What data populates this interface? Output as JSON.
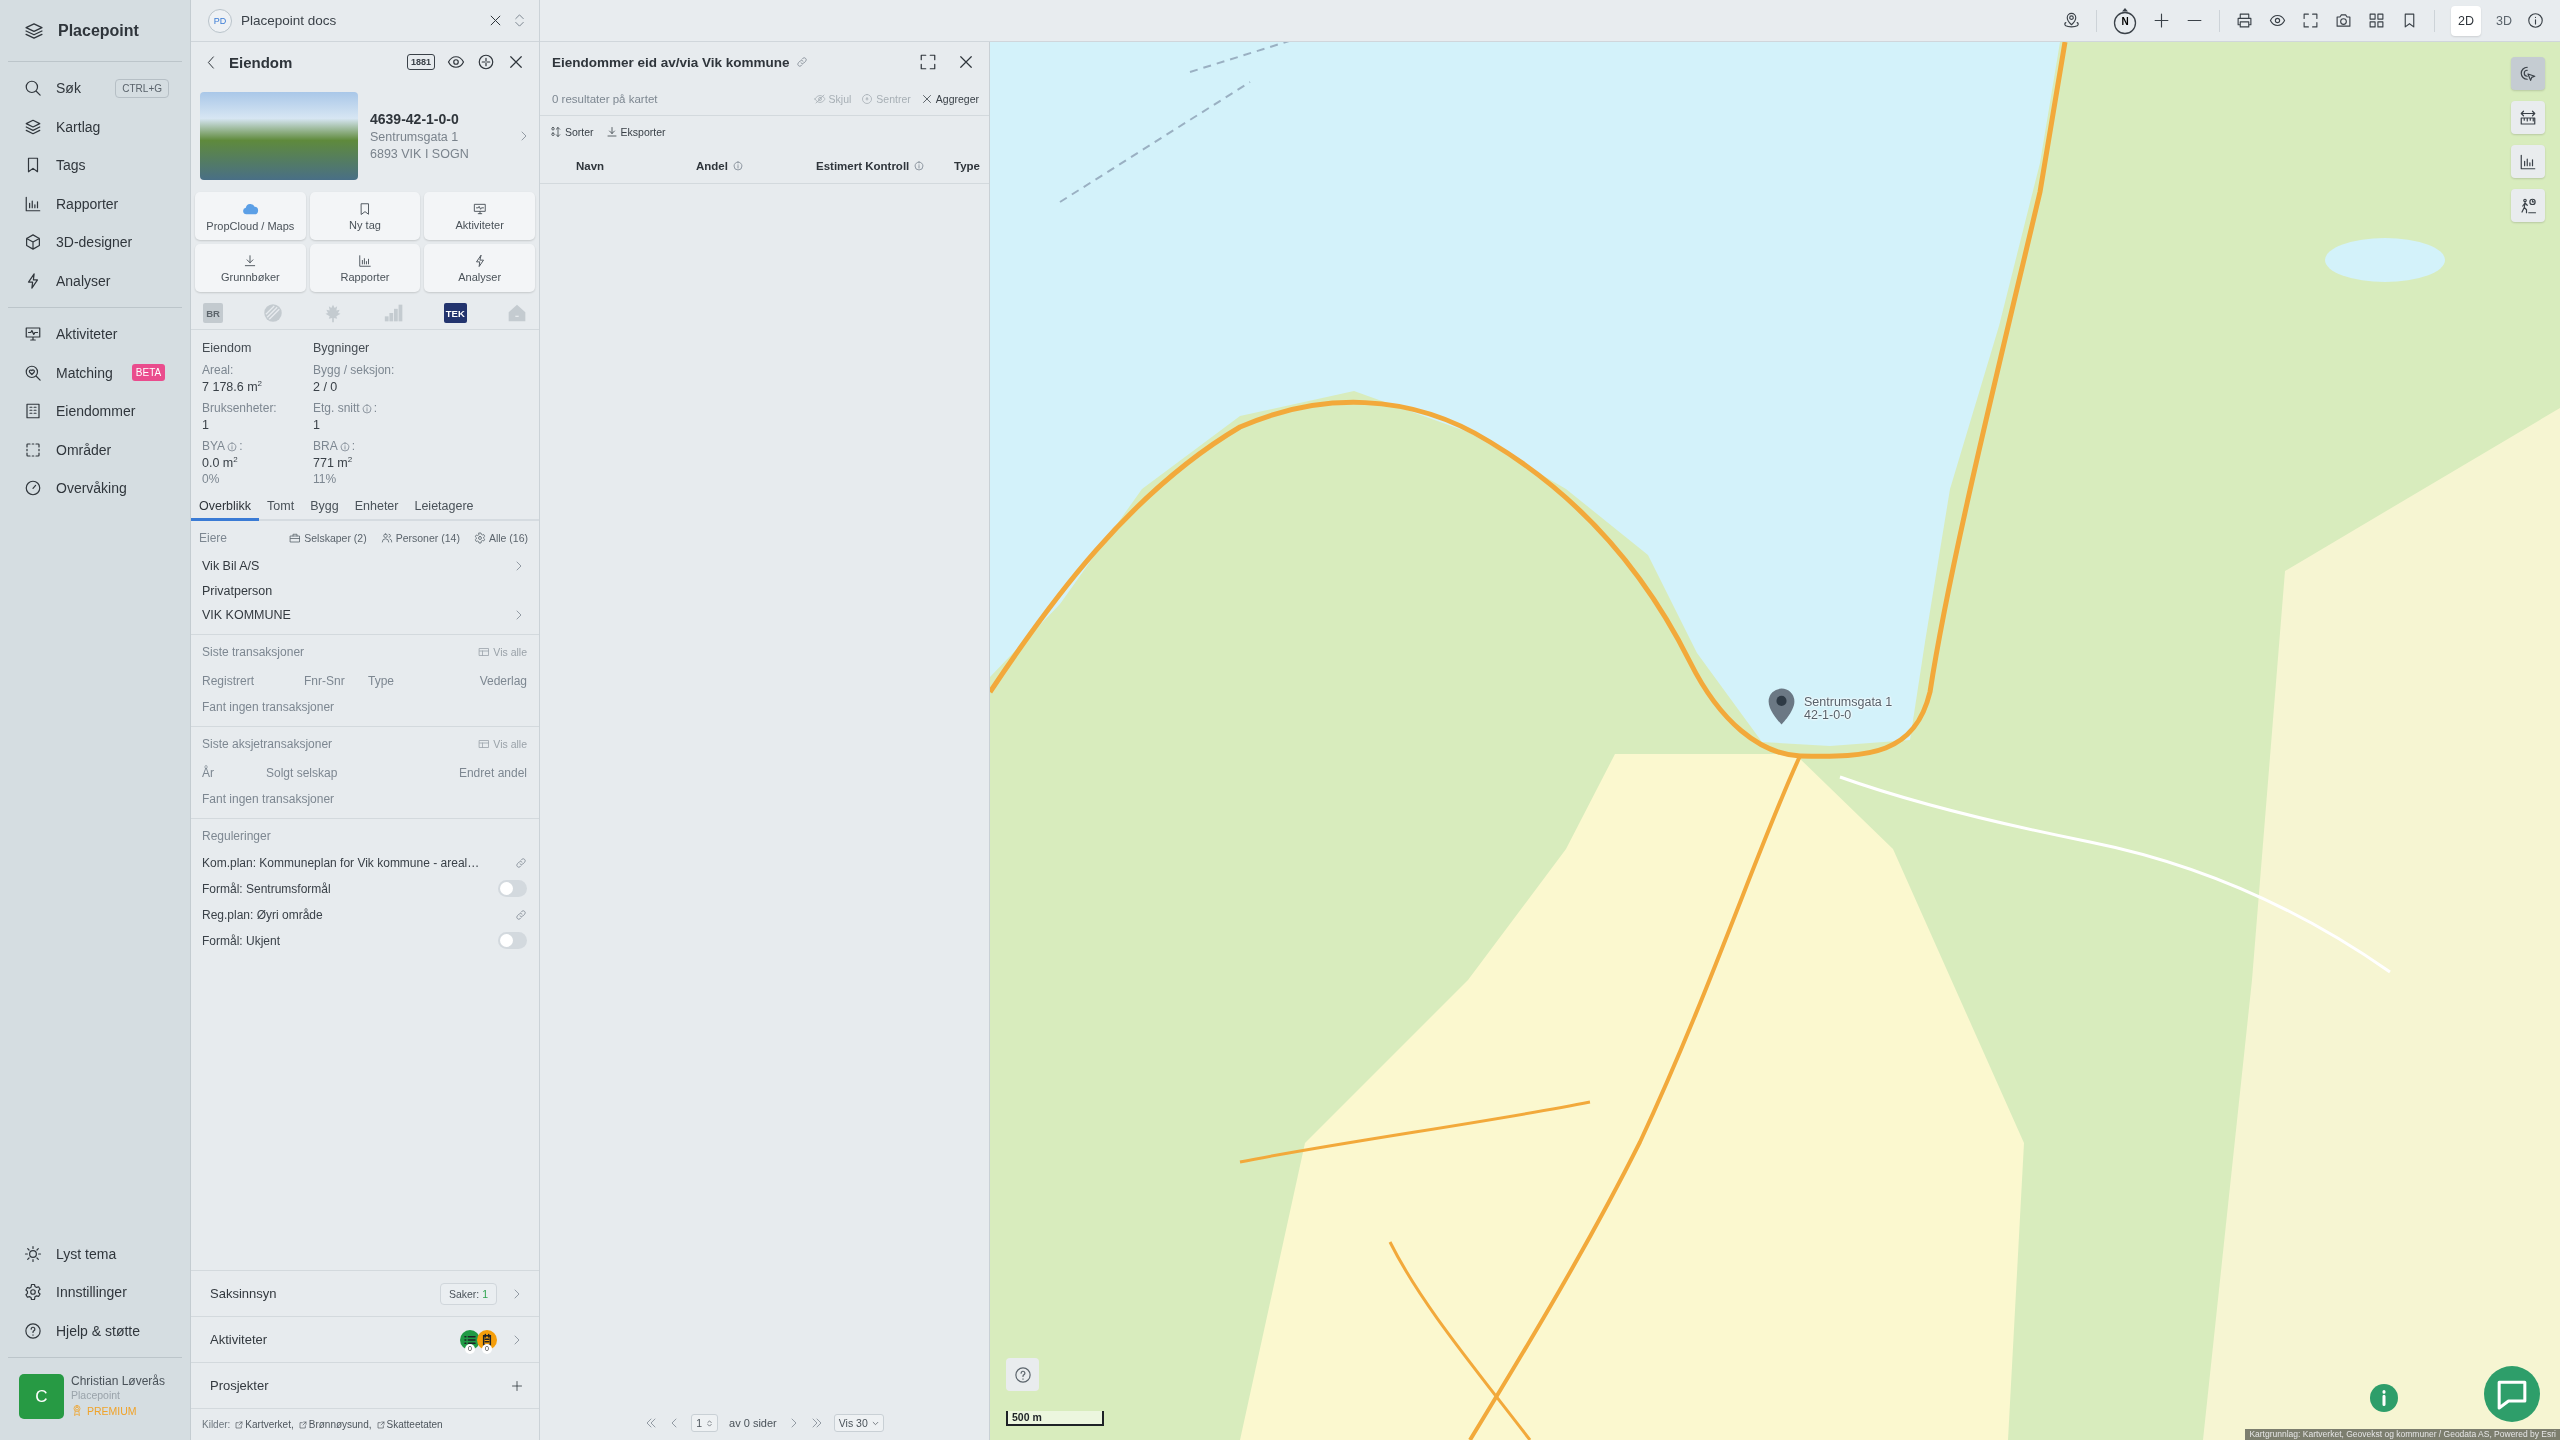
{
  "sidebar": {
    "brand": "Placepoint",
    "nav": [
      {
        "label": "Søk",
        "shortcut": "CTRL+G",
        "selected": false
      },
      {
        "label": "Kartlag",
        "selected": false
      },
      {
        "label": "Tags",
        "selected": false
      },
      {
        "label": "Rapporter",
        "selected": false
      },
      {
        "label": "3D-designer",
        "selected": false
      },
      {
        "label": "Analyser",
        "selected": false
      }
    ],
    "nav_secondary": [
      {
        "label": "Aktiviteter",
        "selected": false
      },
      {
        "label": "Matching",
        "badge": "BETA",
        "selected": false
      },
      {
        "label": "Eiendommer",
        "selected": false
      },
      {
        "label": "Områder",
        "selected": false
      },
      {
        "label": "Overvåking",
        "selected": false
      }
    ],
    "footer_nav": [
      {
        "label": "Lyst tema"
      },
      {
        "label": "Innstillinger"
      },
      {
        "label": "Hjelp & støtte"
      }
    ],
    "user": {
      "initial": "C",
      "name": "Christian Løverås",
      "organization": "Placepoint",
      "plan": "PREMIUM"
    }
  },
  "property_panel": {
    "workspace": {
      "initials": "PD",
      "name": "Placepoint docs"
    },
    "title": "Eiendom",
    "header_badge": "1881",
    "property": {
      "id": "4639-42-1-0-0",
      "address": "Sentrumsgata 1",
      "postal": "6893 VIK I SOGN"
    },
    "actions": [
      {
        "label": "PropCloud / Maps"
      },
      {
        "label": "Ny tag"
      },
      {
        "label": "Aktiviteter"
      },
      {
        "label": "Grunnbøker"
      },
      {
        "label": "Rapporter"
      },
      {
        "label": "Analyser"
      }
    ],
    "data_sources": [
      {
        "kind": "badge",
        "text": "BR",
        "disabled": true
      },
      {
        "kind": "logo",
        "disabled": true
      },
      {
        "kind": "logo",
        "disabled": true
      },
      {
        "kind": "logo",
        "disabled": true
      },
      {
        "kind": "badge",
        "text": "TEK",
        "disabled": false
      },
      {
        "kind": "logo",
        "disabled": true
      }
    ],
    "facts": [
      {
        "heading": "Eiendom",
        "items": [
          {
            "label": "Areal:",
            "value": "7 178.6  m$^{2}$"
          },
          {
            "label": "Bruksenheter:",
            "value": "1"
          },
          {
            "label": "BYA",
            "info": true,
            "suffix": ":",
            "value": "0.0 m$^{2}$",
            "note": "0%"
          }
        ]
      },
      {
        "heading": "Bygninger",
        "items": [
          {
            "label": "Bygg / seksjon:",
            "value": "2 / 0"
          },
          {
            "label": "Etg. snitt",
            "info": true,
            "suffix": ":",
            "value": "1"
          },
          {
            "label": "BRA",
            "info": true,
            "suffix": ":",
            "value": "771 m$^{2}$",
            "note": "11%"
          }
        ]
      }
    ],
    "tabs": [
      {
        "label": "Overblikk",
        "selected": true
      },
      {
        "label": "Tomt",
        "selected": false
      },
      {
        "label": "Bygg",
        "selected": false
      },
      {
        "label": "Enheter",
        "selected": false
      },
      {
        "label": "Leietagere",
        "selected": false
      }
    ],
    "owners": {
      "label": "Eiere",
      "filters": [
        {
          "label": "Selskaper (2)",
          "selected": false
        },
        {
          "label": "Personer (14)",
          "selected": false
        },
        {
          "label": "Alle (16)",
          "selected": false
        }
      ],
      "items": [
        {
          "name": "Vik Bil A/S",
          "has_details": true
        },
        {
          "name": "Privatperson",
          "has_details": false
        },
        {
          "name": "VIK KOMMUNE",
          "has_details": true
        }
      ]
    },
    "transactions": [
      {
        "title": "Siste transaksjoner",
        "action": "Vis alle",
        "columns": [
          "Registrert",
          "Fnr-Snr",
          "Type",
          "Vederlag"
        ],
        "empty": "Fant ingen transaksjoner"
      },
      {
        "title": "Siste aksjetransaksjoner",
        "action": "Vis alle",
        "columns": [
          "År",
          "Solgt selskap",
          "Endret andel"
        ],
        "empty": "Fant ingen transaksjoner"
      }
    ],
    "regulations": {
      "title": "Reguleringer",
      "items": [
        {
          "kind": "link",
          "text": "Kom.plan: Kommuneplan for Vik kommune - areal…"
        },
        {
          "kind": "toggle",
          "text": "Formål: Sentrumsformål",
          "on": false
        },
        {
          "kind": "link",
          "text": "Reg.plan: Øyri område"
        },
        {
          "kind": "toggle",
          "text": "Formål: Ukjent",
          "on": false
        }
      ]
    },
    "sections": [
      {
        "kind": "count",
        "title": "Saksinnsyn",
        "count_label": "Saker:",
        "count": "1"
      },
      {
        "kind": "activities",
        "title": "Aktiviteter",
        "counts": [
          {
            "count": "0",
            "color": "#1f9a45"
          },
          {
            "count": "0",
            "color": "#f59e0b"
          }
        ]
      },
      {
        "kind": "add",
        "title": "Prosjekter"
      }
    ],
    "sources": {
      "label": "Kilder:",
      "links": [
        "Kartverket,",
        "Brønnøysund,",
        "Skatteetaten"
      ]
    }
  },
  "results_panel": {
    "title": "Eiendommer eid av/via Vik kommune",
    "summary": "0 resultater på kartet",
    "actions": [
      {
        "label": "Skjul",
        "disabled": true
      },
      {
        "label": "Sentrer",
        "disabled": true
      },
      {
        "label": "Aggreger",
        "disabled": false
      }
    ],
    "tools": [
      {
        "label": "Sorter"
      },
      {
        "label": "Eksporter"
      }
    ],
    "columns": [
      {
        "label": "Navn",
        "info": false
      },
      {
        "label": "Andel",
        "info": true
      },
      {
        "label": "Estimert Kontroll",
        "info": true
      },
      {
        "label": "Type",
        "info": false
      }
    ],
    "pagination": {
      "page": "1",
      "pages_label": "av 0 sider",
      "page_size": "Vis 30"
    }
  },
  "map": {
    "toolbar": {
      "compass": "N",
      "modes": [
        {
          "label": "2D",
          "selected": true
        },
        {
          "label": "3D",
          "selected": false
        }
      ]
    },
    "side_tools": [
      {
        "selected": true
      },
      {
        "selected": false
      },
      {
        "selected": false
      },
      {
        "selected": false
      }
    ],
    "marker": {
      "label": "Sentrumsgata 1",
      "sublabel": "42-1-0-0"
    },
    "scale": "500 m",
    "attribution": "Kartgrunnlag: Kartverket, Geovekst og kommuner / Geodata AS, Powered by Esri"
  }
}
